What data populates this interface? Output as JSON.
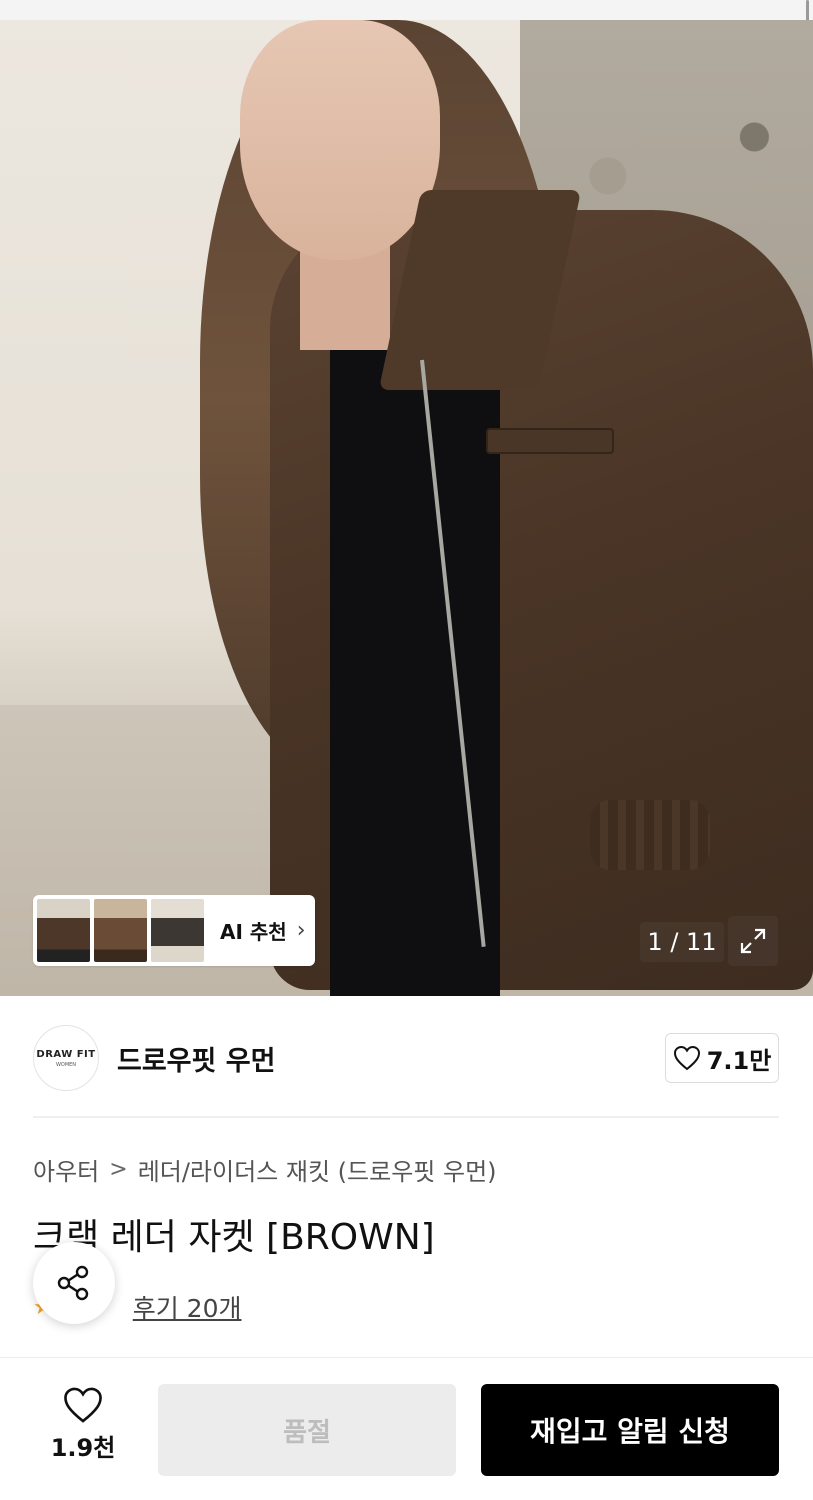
{
  "gallery": {
    "counter": "1 / 11",
    "ai_label": "AI 추천",
    "ai_chevron": "›"
  },
  "brand": {
    "logo_line1": "DRAW FIT",
    "logo_line2": "WOMEN",
    "name": "드로우핏 우먼",
    "likes": "7.1만"
  },
  "breadcrumb": {
    "category": "아우터",
    "separator": ">",
    "subcategory": "레더/라이더스 재킷 (드로우핏 우먼)"
  },
  "product": {
    "title": "크랙 레더 자켓 [BROWN]",
    "reviews": "후기 20개"
  },
  "bottom_bar": {
    "wish_count": "1.9천",
    "soldout_label": "품절",
    "restock_label": "재입고 알림 신청"
  },
  "colors": {
    "accent_star": "#f5a623",
    "primary_button": "#000000",
    "disabled_button": "#ececec"
  }
}
